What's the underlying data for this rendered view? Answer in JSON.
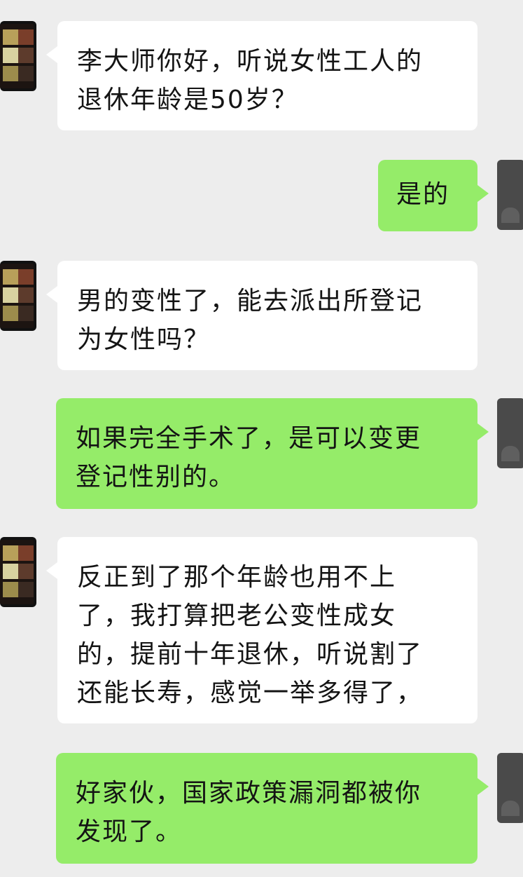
{
  "chat": {
    "messages": [
      {
        "side": "left",
        "text": "李大师你好，听说女性工人的\n退休年龄是50岁？"
      },
      {
        "side": "right",
        "text": "是的"
      },
      {
        "side": "left",
        "text": "男的变性了，能去派出所登记\n为女性吗？"
      },
      {
        "side": "right",
        "text": "如果完全手术了，是可以变更\n登记性别的。"
      },
      {
        "side": "left",
        "text": "反正到了那个年龄也用不上\n了，我打算把老公变性成女\n的，提前十年退休，听说割了\n还能长寿，感觉一举多得了，"
      },
      {
        "side": "right",
        "text": "好家伙，国家政策漏洞都被你\n发现了。"
      }
    ]
  },
  "colors": {
    "background": "#ededed",
    "incoming_bubble": "#ffffff",
    "outgoing_bubble": "#95ec69",
    "text": "#141414"
  },
  "icons": {
    "left_avatar": "user-avatar-icon",
    "right_avatar": "self-avatar-icon"
  }
}
